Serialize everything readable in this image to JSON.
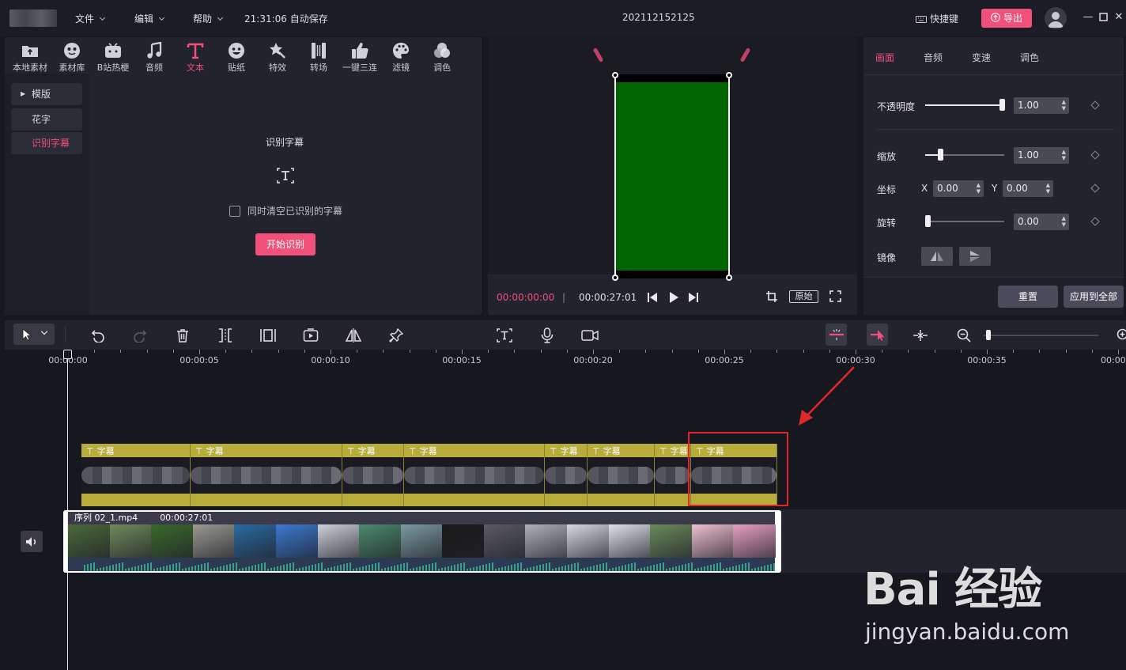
{
  "titlebar": {
    "menu": [
      "文件",
      "编辑",
      "帮助"
    ],
    "autosave": "21:31:06 自动保存",
    "project_name": "202112152125",
    "shortcut_label": "快捷键",
    "export_label": "导出"
  },
  "toolbar": {
    "items": [
      "本地素材",
      "素材库",
      "B站热梗",
      "音频",
      "文本",
      "贴纸",
      "特效",
      "转场",
      "一键三连",
      "滤镜",
      "调色"
    ],
    "active": "文本"
  },
  "subnav": {
    "items": [
      "模版",
      "花字",
      "识别字幕"
    ],
    "active": "识别字幕"
  },
  "recognize": {
    "title": "识别字幕",
    "checkbox_label": "同时清空已识别的字幕",
    "start_label": "开始识别"
  },
  "player": {
    "current_time": "00:00:00:00",
    "separator": "|",
    "duration": "00:00:27:01",
    "original_label": "原始"
  },
  "props": {
    "tabs": [
      "画面",
      "音频",
      "变速",
      "调色"
    ],
    "active_tab": "画面",
    "opacity": {
      "label": "不透明度",
      "value": "1.00",
      "level": 1.0
    },
    "scale": {
      "label": "缩放",
      "value": "1.00",
      "level": 0.2
    },
    "position": {
      "label": "坐标",
      "x_label": "X",
      "x_value": "0.00",
      "y_label": "Y",
      "y_value": "0.00"
    },
    "rotation": {
      "label": "旋转",
      "value": "0.00",
      "level": 0.0
    },
    "mirror": {
      "label": "镜像"
    },
    "reset_label": "重置",
    "apply_all_label": "应用到全部"
  },
  "timeline": {
    "ticks": [
      "00:00:00",
      "00:00:05",
      "00:00:10",
      "00:00:15",
      "00:00:20",
      "00:00:25",
      "00:00:30",
      "00:00:35",
      "00:00:"
    ],
    "subtitle_clip_label": "字幕",
    "subtitle_clip_count": 8,
    "video_clip": {
      "name": "序列 02_1.mp4",
      "duration": "00:00:27:01"
    }
  },
  "watermark": {
    "brand": "Bai 经验",
    "url": "jingyan.baidu.com"
  },
  "colors": {
    "accent": "#f0507a",
    "subtitle_clip": "#b8ac3a",
    "highlight": "#e0282a",
    "screen": "#006400"
  }
}
